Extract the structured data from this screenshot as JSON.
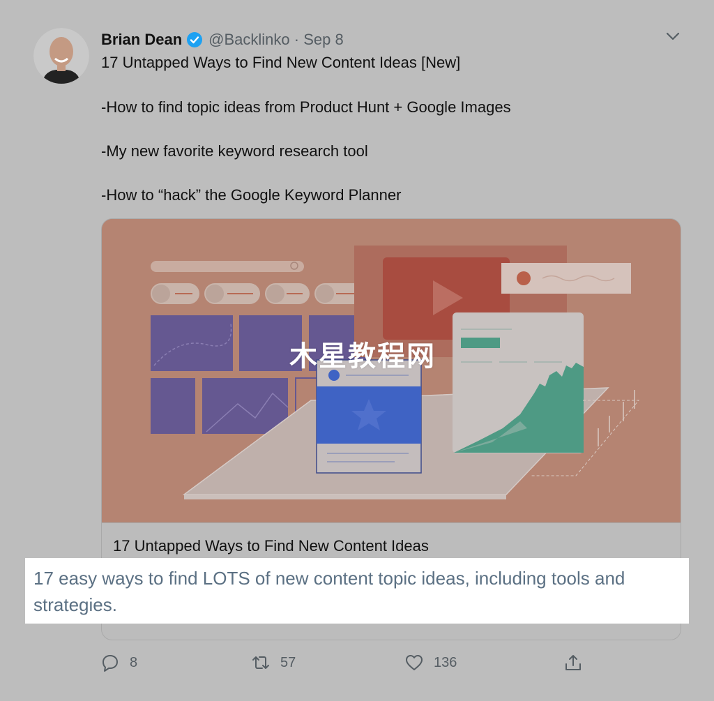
{
  "tweet": {
    "author_name": "Brian Dean",
    "handle": "@Backlinko",
    "separator": "·",
    "date": "Sep 8",
    "lines": [
      "17 Untapped Ways to Find New Content Ideas [New]",
      "-How to find topic ideas from Product Hunt + Google Images",
      "-My new favorite keyword research tool",
      "-How to “hack” the Google Keyword Planner"
    ]
  },
  "card": {
    "title": "17 Untapped Ways to Find New Content Ideas",
    "description": "17 easy ways to find LOTS of new content topic ideas, including tools and strategies.",
    "watermark": "木星教程网"
  },
  "actions": {
    "replies": "8",
    "retweets": "57",
    "likes": "136"
  },
  "colors": {
    "verified": "#1da1f2",
    "card_image_bg": "#b58472",
    "description_text": "#5b7083"
  },
  "icons": [
    "verified-badge-icon",
    "chevron-down-icon",
    "reply-icon",
    "retweet-icon",
    "like-icon",
    "share-icon"
  ]
}
